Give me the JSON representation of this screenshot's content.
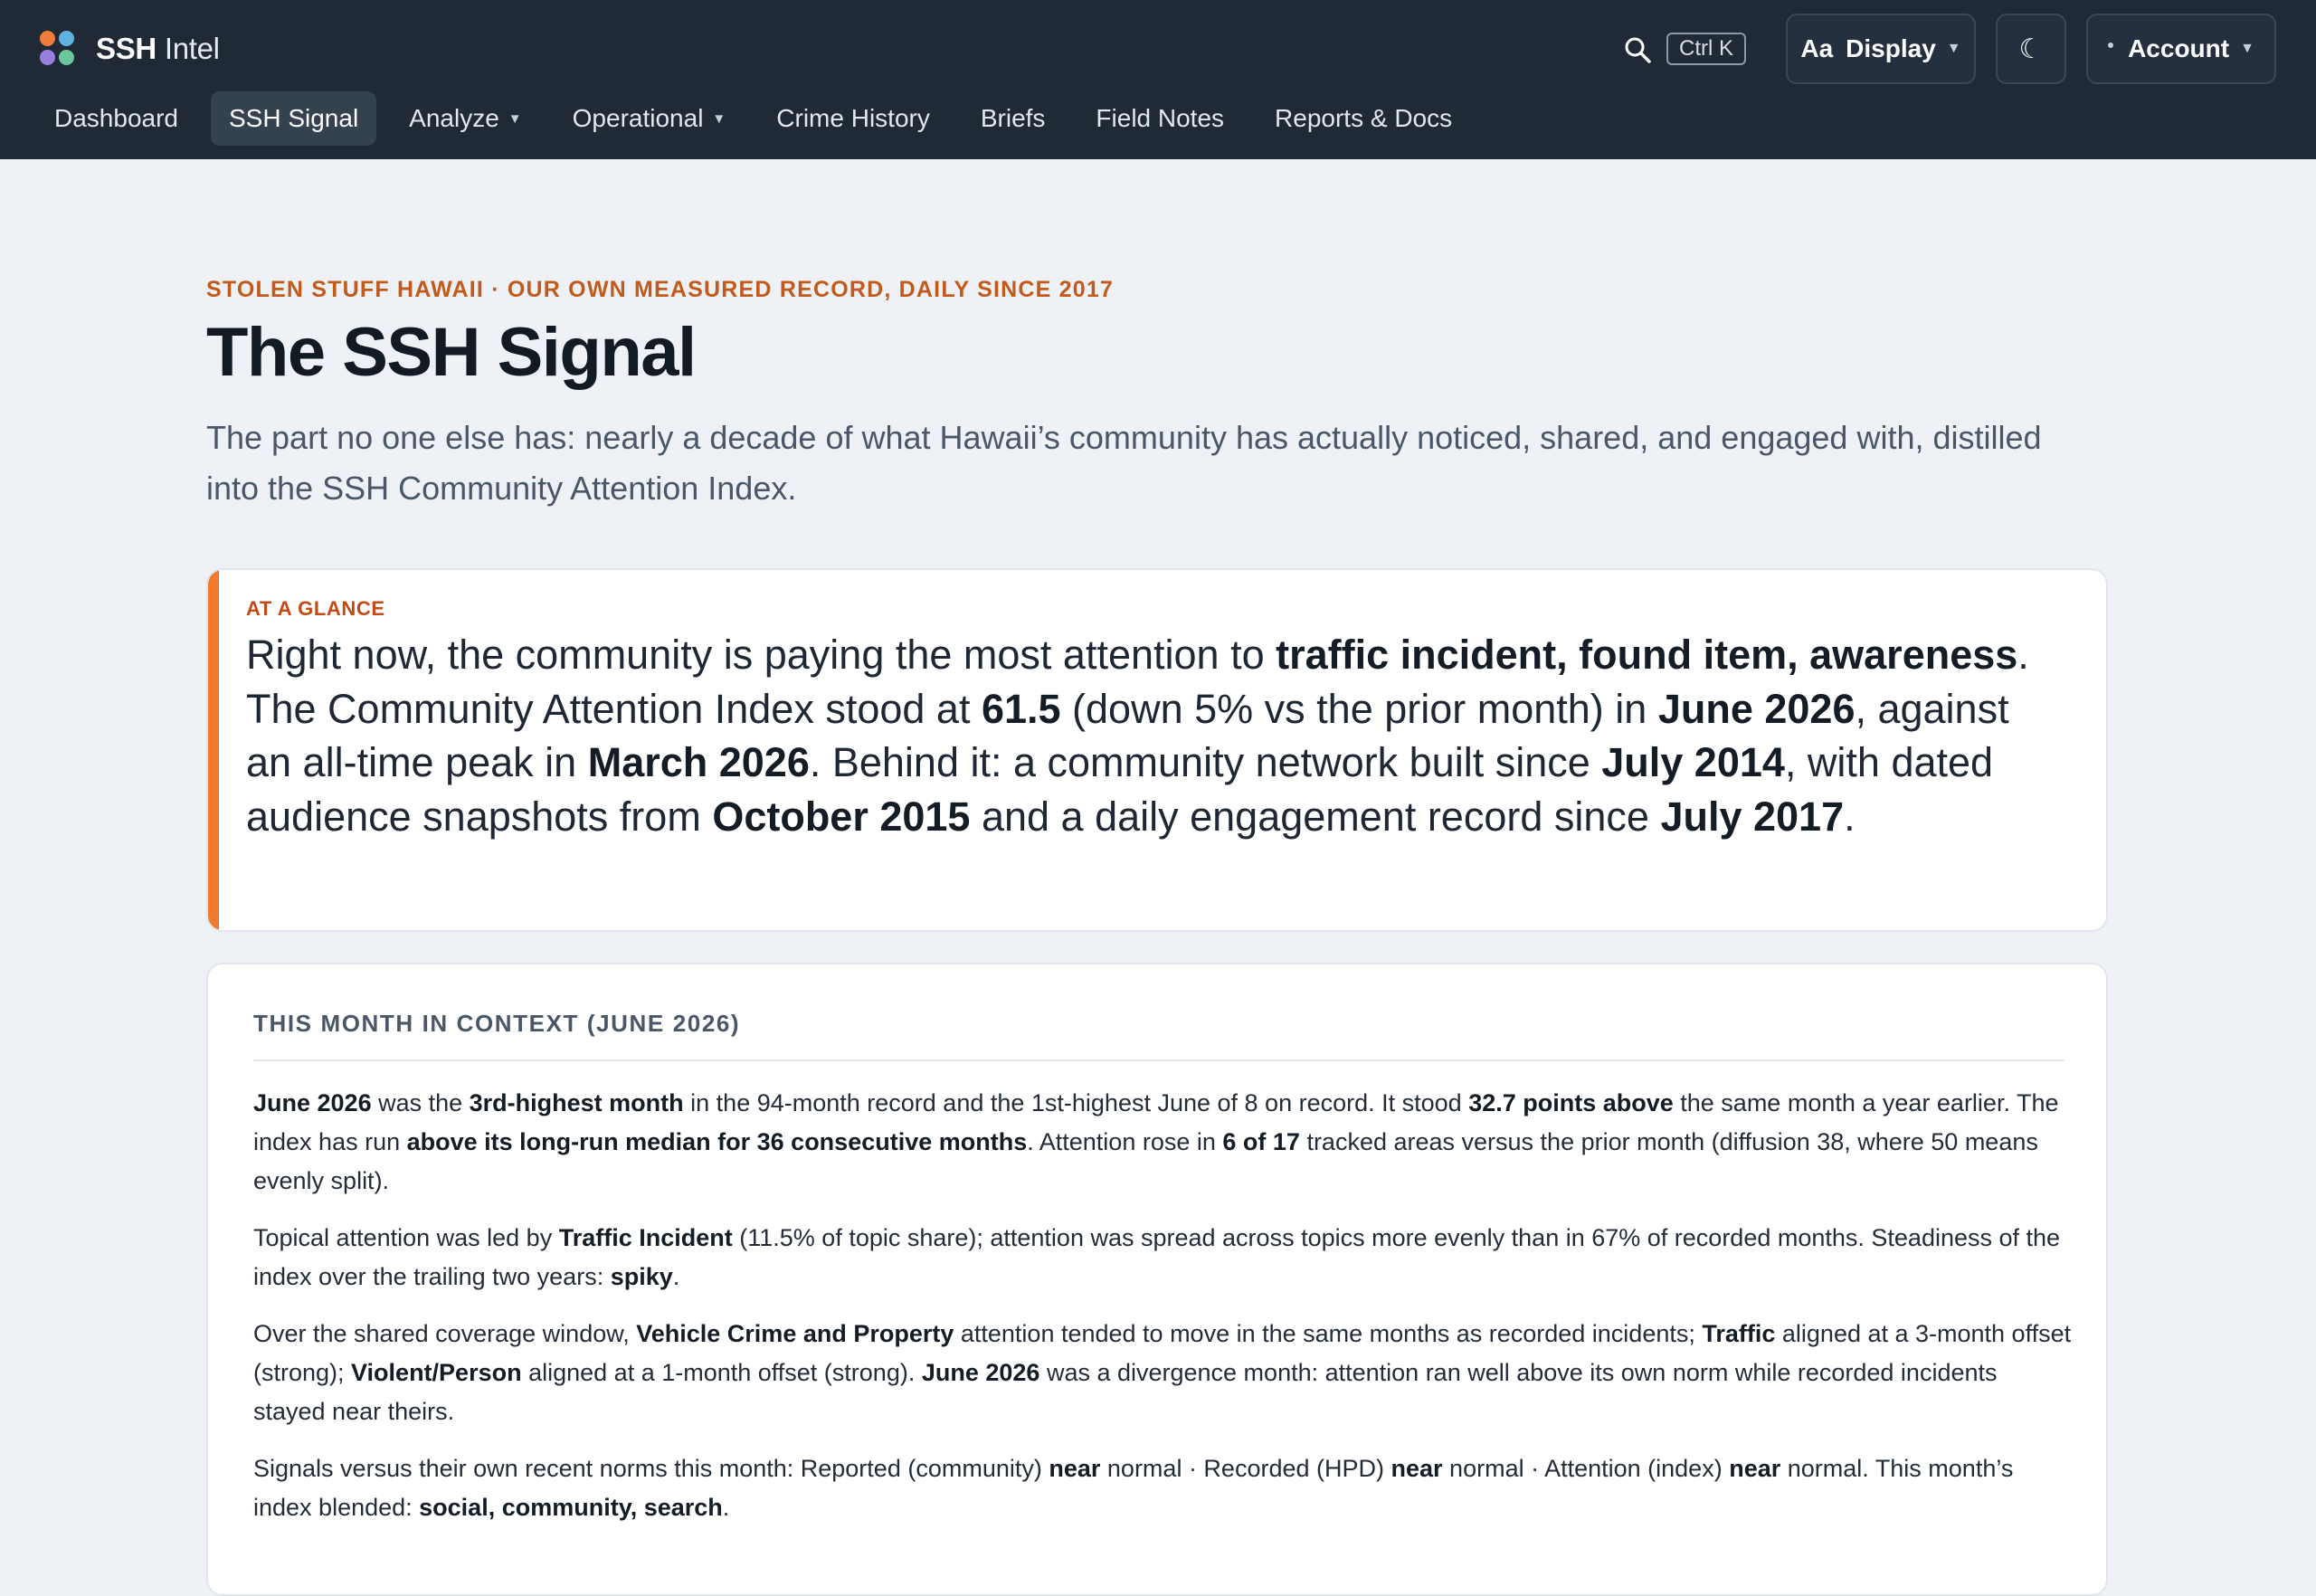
{
  "app": {
    "brand_bold": "SSH",
    "brand_rest": " Intel",
    "shortcut": "Ctrl K",
    "display_label": "Display",
    "display_prefix": "Aa",
    "theme_glyph": "☾",
    "account_label": "Account"
  },
  "icons": {
    "search": "search-icon",
    "theme": "moon-icon",
    "logo": "four-dot-logo"
  },
  "nav": [
    {
      "label": "Dashboard"
    },
    {
      "label": "SSH Signal",
      "active": true
    },
    {
      "label": "Analyze",
      "dropdown": true
    },
    {
      "label": "Operational",
      "dropdown": true
    },
    {
      "label": "Crime History"
    },
    {
      "label": "Briefs"
    },
    {
      "label": "Field Notes"
    },
    {
      "label": "Reports & Docs"
    }
  ],
  "page": {
    "eyebrow": "Stolen Stuff Hawaii · Our own measured record, daily since 2017",
    "title": "The SSH Signal",
    "lede": "The part no one else has: nearly a decade of what Hawaii’s community has actually noticed, shared, and engaged with, distilled into the SSH Community Attention Index."
  },
  "glance": {
    "label": "AT A GLANCE",
    "segments": [
      {
        "t": "Right now, the community is paying the most attention to "
      },
      {
        "t": "traffic incident, found item, awareness",
        "b": true
      },
      {
        "t": ". The Community Attention Index stood at "
      },
      {
        "t": "61.5",
        "b": true
      },
      {
        "t": " (down 5% vs the prior month) in "
      },
      {
        "t": "June 2026",
        "b": true
      },
      {
        "t": ", against an all-time peak in "
      },
      {
        "t": "March 2026",
        "b": true
      },
      {
        "t": ". Behind it: a community network built since "
      },
      {
        "t": "July 2014",
        "b": true
      },
      {
        "t": ", with dated audience snapshots from "
      },
      {
        "t": "October 2015",
        "b": true
      },
      {
        "t": " and a daily engagement record since "
      },
      {
        "t": "July 2017",
        "b": true
      },
      {
        "t": "."
      }
    ]
  },
  "context": {
    "heading": "THIS MONTH IN CONTEXT (JUNE 2026)",
    "paragraphs": [
      [
        {
          "t": "June 2026",
          "b": true
        },
        {
          "t": " was the "
        },
        {
          "t": "3rd-highest month",
          "b": true
        },
        {
          "t": " in the 94-month record and the 1st-highest June of 8 on record. It stood "
        },
        {
          "t": "32.7 points above",
          "b": true
        },
        {
          "t": " the same month a year earlier. The index has run "
        },
        {
          "t": "above its long-run median for 36 consecutive months",
          "b": true
        },
        {
          "t": ". Attention rose in "
        },
        {
          "t": "6 of 17",
          "b": true
        },
        {
          "t": " tracked areas versus the prior month (diffusion 38, where 50 means evenly split)."
        }
      ],
      [
        {
          "t": "Topical attention was led by "
        },
        {
          "t": "Traffic Incident",
          "b": true
        },
        {
          "t": " (11.5% of topic share); attention was spread across topics more evenly than in 67% of recorded months. Steadiness of the index over the trailing two years: "
        },
        {
          "t": "spiky",
          "b": true
        },
        {
          "t": "."
        }
      ],
      [
        {
          "t": "Over the shared coverage window, "
        },
        {
          "t": "Vehicle Crime and Property",
          "b": true
        },
        {
          "t": " attention tended to move in the same months as recorded incidents; "
        },
        {
          "t": "Traffic",
          "b": true
        },
        {
          "t": " aligned at a 3-month offset (strong); "
        },
        {
          "t": "Violent/Person",
          "b": true
        },
        {
          "t": " aligned at a 1-month offset (strong). "
        },
        {
          "t": "June 2026",
          "b": true
        },
        {
          "t": " was a divergence month: attention ran well above its own norm while recorded incidents stayed near theirs."
        }
      ],
      [
        {
          "t": "Signals versus their own recent norms this month: Reported (community) "
        },
        {
          "t": "near",
          "b": true
        },
        {
          "t": " normal · Recorded (HPD) "
        },
        {
          "t": "near",
          "b": true
        },
        {
          "t": " normal · Attention (index) "
        },
        {
          "t": "near",
          "b": true
        },
        {
          "t": " normal. This month’s index blended: "
        },
        {
          "t": "social, community, search",
          "b": true
        },
        {
          "t": "."
        }
      ]
    ]
  }
}
